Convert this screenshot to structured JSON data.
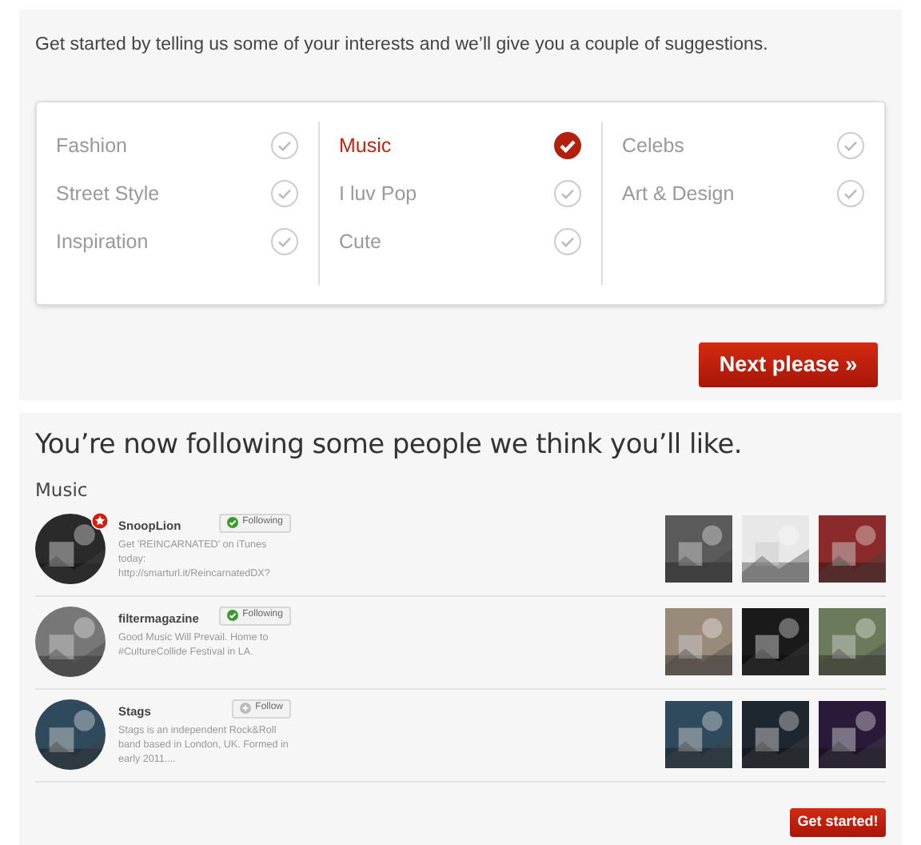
{
  "intro": "Get started by telling us some of your interests and we’ll give you a couple of suggestions.",
  "interest_columns": [
    [
      {
        "label": "Fashion",
        "selected": false
      },
      {
        "label": "Street Style",
        "selected": false
      },
      {
        "label": "Inspiration",
        "selected": false
      }
    ],
    [
      {
        "label": "Music",
        "selected": true
      },
      {
        "label": "I luv Pop",
        "selected": false
      },
      {
        "label": "Cute",
        "selected": false
      }
    ],
    [
      {
        "label": "Celebs",
        "selected": false
      },
      {
        "label": "Art & Design",
        "selected": false
      }
    ]
  ],
  "next_button": "Next please »",
  "following_title": "You’re now following some people we think you’ll like.",
  "category": "Music",
  "blogs": [
    {
      "name": "SnoopLion",
      "featured": true,
      "following": true,
      "button": "Following",
      "description": "Get 'REINCARNATED' on iTunes today: http://smarturl.it/ReincarnatedDX?"
    },
    {
      "name": "filtermagazine",
      "featured": false,
      "following": true,
      "button": "Following",
      "description": "Good Music Will Prevail. Home to #CultureCollide Festival in LA."
    },
    {
      "name": "Stags",
      "featured": false,
      "following": false,
      "button": "Follow",
      "description": "Stags is an independent Rock&Roll band based in London, UK. Formed in early 2011...."
    }
  ],
  "start_button": "Get started!"
}
